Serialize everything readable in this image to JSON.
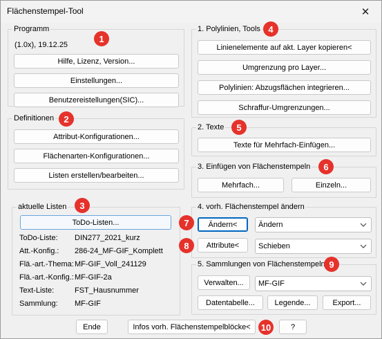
{
  "window": {
    "title": "Flächenstempel-Tool",
    "close_glyph": "✕"
  },
  "programm": {
    "label": "Programm",
    "version": "(1.0x), 19.12.25",
    "buttons": [
      "Hilfe, Lizenz, Version...",
      "Einstellungen...",
      "Benutzereistellungen(SIC)..."
    ]
  },
  "definitionen": {
    "label": "Definitionen",
    "buttons": [
      "Attribut-Konfigurationen...",
      "Flächenarten-Konfigurationen...",
      "Listen erstellen/bearbeiten..."
    ]
  },
  "aktuelle_listen": {
    "label": "aktuelle Listen",
    "todo_button": "ToDo-Listen...",
    "rows": [
      {
        "key": "ToDo-Liste:",
        "value": "DIN277_2021_kurz"
      },
      {
        "key": "Att.-Konfig.:",
        "value": "286-24_MF-GIF_Komplett"
      },
      {
        "key": "Flä.-art.-Thema:",
        "value": "MF-GIF_Voll_241129"
      },
      {
        "key": "Flä.-art.-Konfig.:",
        "value": "MF-GIF-2a"
      },
      {
        "key": "Text-Liste:",
        "value": "FST_Hausnummer"
      },
      {
        "key": "Sammlung:",
        "value": "MF-GIF"
      }
    ]
  },
  "polylinien": {
    "label": "1. Polylinien, Tools",
    "buttons": [
      "Linienelemente auf akt. Layer kopieren<",
      "Umgrenzung pro Layer...",
      "Polylinien: Abzugsflächen integrieren...",
      "Schraffur-Umgrenzungen..."
    ]
  },
  "texte": {
    "label": "2. Texte",
    "button": "Texte für Mehrfach-Einfügen..."
  },
  "einfuegen": {
    "label": "3. Einfügen von Flächenstempeln",
    "mehrfach": "Mehrfach...",
    "einzeln": "Einzeln..."
  },
  "aendern": {
    "label": "4. vorh. Flächenstempel ändern",
    "aendern_button": "Ändern<",
    "aendern_select": "Ändern",
    "attribute_button": "Attribute<",
    "attribute_select": "Schieben"
  },
  "sammlungen": {
    "label": "5. Sammlungen von Flächenstempeln",
    "verwalten": "Verwalten...",
    "select": "MF-GIF",
    "datentabelle": "Datentabelle...",
    "legende": "Legende...",
    "export": "Export..."
  },
  "footer": {
    "ende": "Ende",
    "infos": "Infos vorh. Flächenstempelblöcke<",
    "help": "?"
  },
  "badges": [
    "1",
    "2",
    "3",
    "4",
    "5",
    "6",
    "7",
    "8",
    "9",
    "10"
  ],
  "colors": {
    "badge": "#e5322b",
    "focus": "#0067c0"
  }
}
